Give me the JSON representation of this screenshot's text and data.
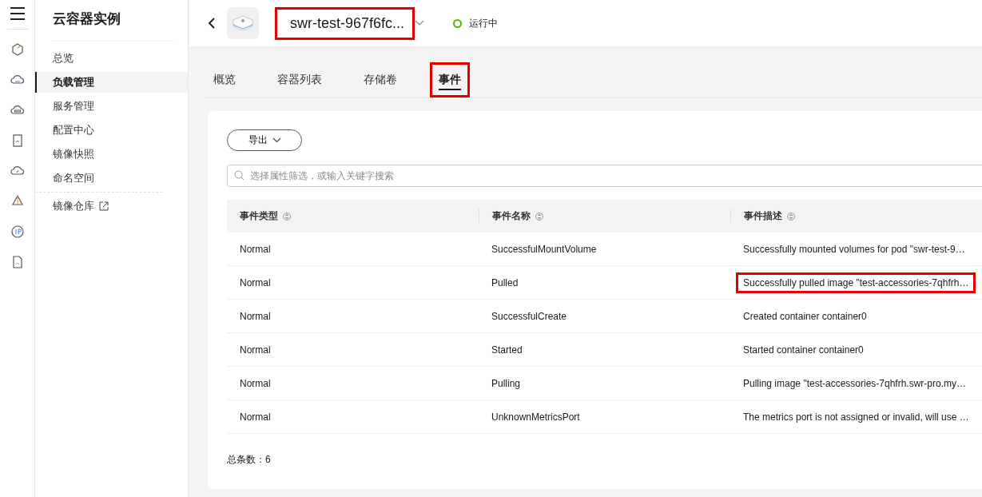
{
  "sidebar": {
    "title": "云容器实例",
    "items": [
      {
        "label": "总览",
        "selected": false,
        "external": false
      },
      {
        "label": "负载管理",
        "selected": true,
        "external": false
      },
      {
        "label": "服务管理",
        "selected": false,
        "external": false
      },
      {
        "label": "配置中心",
        "selected": false,
        "external": false
      },
      {
        "label": "镜像快照",
        "selected": false,
        "external": false
      },
      {
        "label": "命名空间",
        "selected": false,
        "external": false
      },
      {
        "label": "镜像仓库",
        "selected": false,
        "external": true
      }
    ]
  },
  "header": {
    "title": "swr-test-967f6fc...",
    "title_highlighted": true,
    "status": "运行中"
  },
  "tabs": [
    {
      "label": "概览",
      "selected": false,
      "highlighted": false
    },
    {
      "label": "容器列表",
      "selected": false,
      "highlighted": false
    },
    {
      "label": "存储卷",
      "selected": false,
      "highlighted": false
    },
    {
      "label": "事件",
      "selected": true,
      "highlighted": true
    }
  ],
  "export_button": "导出",
  "search": {
    "placeholder": "选择属性筛选，或输入关键字搜索"
  },
  "table": {
    "columns": [
      "事件类型",
      "事件名称",
      "事件描述"
    ],
    "rows": [
      {
        "cells": [
          "Normal",
          "SuccessfulMountVolume",
          "Successfully mounted volumes for pod \"swr-test-9…"
        ],
        "highlighted": false
      },
      {
        "cells": [
          "Normal",
          "Pulled",
          "Successfully pulled image \"test-accessories-7qhfrh…"
        ],
        "highlighted": true
      },
      {
        "cells": [
          "Normal",
          "SuccessfulCreate",
          "Created container container0"
        ],
        "highlighted": false
      },
      {
        "cells": [
          "Normal",
          "Started",
          "Started container container0"
        ],
        "highlighted": false
      },
      {
        "cells": [
          "Normal",
          "Pulling",
          "Pulling image \"test-accessories-7qhfrh.swr-pro.my…"
        ],
        "highlighted": false
      },
      {
        "cells": [
          "Normal",
          "UnknownMetricsPort",
          "The metrics port is not assigned or invalid, will use …"
        ],
        "highlighted": false
      }
    ]
  },
  "total": "总条数：6"
}
